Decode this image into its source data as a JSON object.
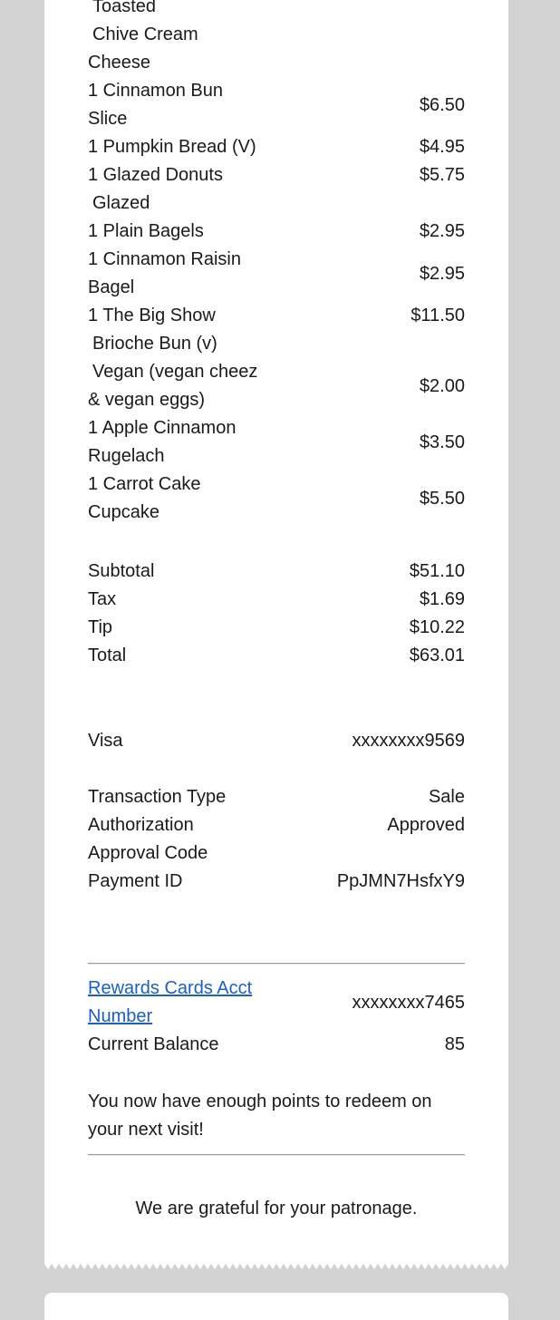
{
  "items": {
    "lead_lines": [
      "Toasted",
      "Chive Cream",
      "Cheese"
    ],
    "cinnamon_bun": {
      "line1": "1 Cinnamon Bun",
      "line2": "Slice",
      "price": "$6.50"
    },
    "pumpkin": {
      "name": "1 Pumpkin Bread (V)",
      "price": "$4.95"
    },
    "donuts": {
      "name": "1 Glazed Donuts",
      "price": "$5.75",
      "mod": "Glazed"
    },
    "plain_bagels": {
      "name": "1 Plain Bagels",
      "price": "$2.95"
    },
    "raisin_bagel": {
      "line1": "1 Cinnamon Raisin",
      "line2": "Bagel",
      "price": "$2.95"
    },
    "big_show": {
      "name": "1 The Big Show",
      "price": "$11.50",
      "mod1": "Brioche Bun (v)",
      "mod2_line1": "Vegan (vegan cheez",
      "mod2_line2": "& vegan eggs)",
      "mod2_price": "$2.00"
    },
    "rugelach": {
      "line1": "1 Apple Cinnamon",
      "line2": "Rugelach",
      "price": "$3.50"
    },
    "cupcake": {
      "line1": "1 Carrot Cake",
      "line2": "Cupcake",
      "price": "$5.50"
    }
  },
  "totals": {
    "subtotal_label": "Subtotal",
    "subtotal": "$51.10",
    "tax_label": "Tax",
    "tax": "$1.69",
    "tip_label": "Tip",
    "tip": "$10.22",
    "total_label": "Total",
    "total": "$63.01"
  },
  "payment": {
    "card_label": "Visa",
    "card_number": "xxxxxxxx9569",
    "type_label": "Transaction Type",
    "type_value": "Sale",
    "auth_label": "Authorization",
    "auth_value": "Approved",
    "approval_label": "Approval Code",
    "payment_id_label": "Payment ID",
    "payment_id": "PpJMN7HsfxY9"
  },
  "rewards": {
    "link_line1": "Rewards Cards Acct",
    "link_line2": "Number",
    "acct_number": "xxxxxxxx7465",
    "balance_label": "Current Balance",
    "balance": "85",
    "message": "You now have enough points to redeem on your next visit!"
  },
  "footer": {
    "thanks": "We are grateful for your patronage."
  },
  "colors": {
    "background": "#d3d3d3",
    "receipt": "#ffffff",
    "link": "#1a5fc4"
  }
}
